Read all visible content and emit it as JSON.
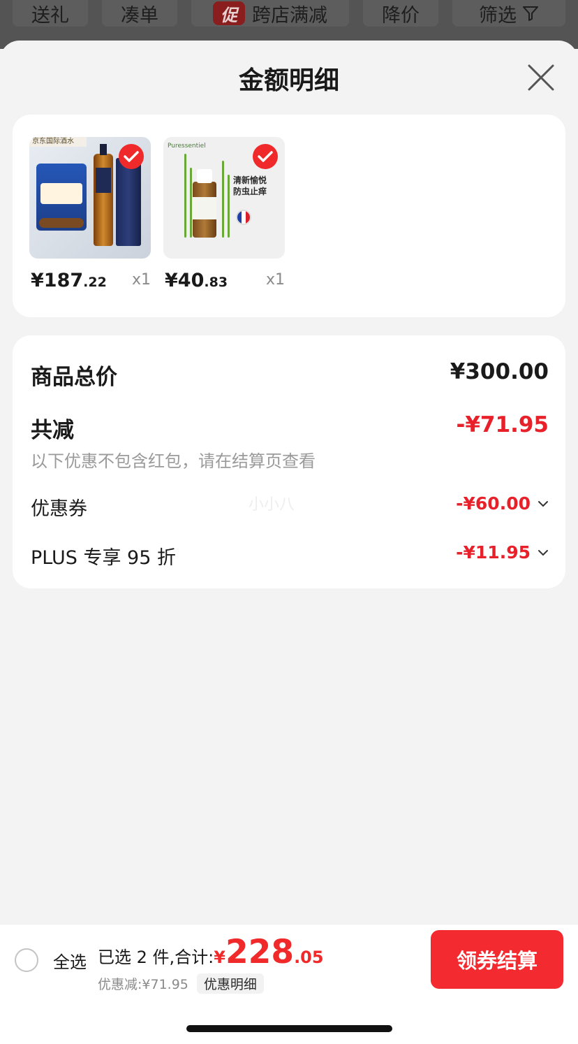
{
  "filter_bar": {
    "items": [
      "送礼",
      "凑单",
      "跨店满减",
      "降价",
      "筛选"
    ],
    "promo_badge": "促"
  },
  "sheet": {
    "title": "金额明细"
  },
  "products": [
    {
      "banner": "京东国际酒水",
      "price_main": "¥187",
      "price_dec": ".22",
      "qty": "x1"
    },
    {
      "brand": "Puressentiel",
      "art_text_1": "清新愉悦",
      "art_text_2": "防虫止痒",
      "price_main": "¥40",
      "price_dec": ".83",
      "qty": "x1"
    }
  ],
  "summary": {
    "total_label": "商品总价",
    "total_value": "¥300.00",
    "reduce_label": "共减",
    "reduce_value": "-¥71.95",
    "reduce_note": "以下优惠不包含红包，请在结算页查看",
    "coupon_label": "优惠券",
    "coupon_value": "-¥60.00",
    "plus_label": "PLUS 专享 95 折",
    "plus_value": "-¥11.95",
    "watermark": "小小八"
  },
  "bottom_bar": {
    "select_all": "全选",
    "selected_text": "已选 2 件,合计:",
    "currency": "¥",
    "total_int": "228",
    "total_dec": ".05",
    "discount_text": "优惠减:¥71.95",
    "detail_tag": "优惠明细",
    "checkout": "领券结算"
  },
  "colors": {
    "accent": "#f02a2a",
    "checkout_button": "#f32a30"
  }
}
